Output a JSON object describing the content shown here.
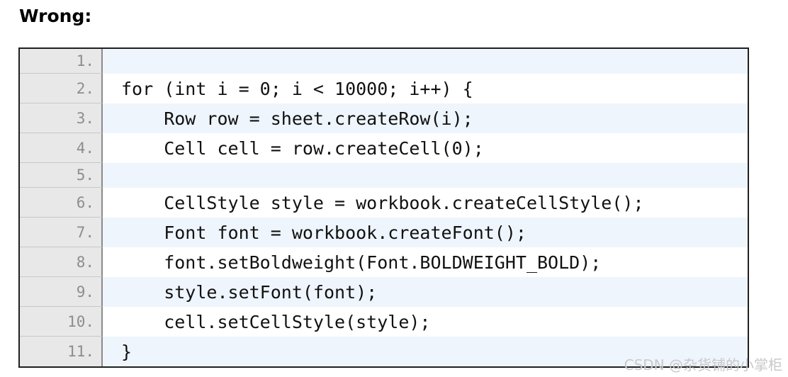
{
  "heading": "Wrong:",
  "code": {
    "lines": [
      {
        "number": "1.",
        "text": ""
      },
      {
        "number": "2.",
        "text": "for (int i = 0; i < 10000; i++) {"
      },
      {
        "number": "3.",
        "text": "    Row row = sheet.createRow(i);"
      },
      {
        "number": "4.",
        "text": "    Cell cell = row.createCell(0);"
      },
      {
        "number": "5.",
        "text": ""
      },
      {
        "number": "6.",
        "text": "    CellStyle style = workbook.createCellStyle();"
      },
      {
        "number": "7.",
        "text": "    Font font = workbook.createFont();"
      },
      {
        "number": "8.",
        "text": "    font.setBoldweight(Font.BOLDWEIGHT_BOLD);"
      },
      {
        "number": "9.",
        "text": "    style.setFont(font);"
      },
      {
        "number": "10.",
        "text": "    cell.setCellStyle(style);"
      },
      {
        "number": "11.",
        "text": "}"
      }
    ]
  },
  "watermark": "CSDN @杂货铺的小掌柜"
}
